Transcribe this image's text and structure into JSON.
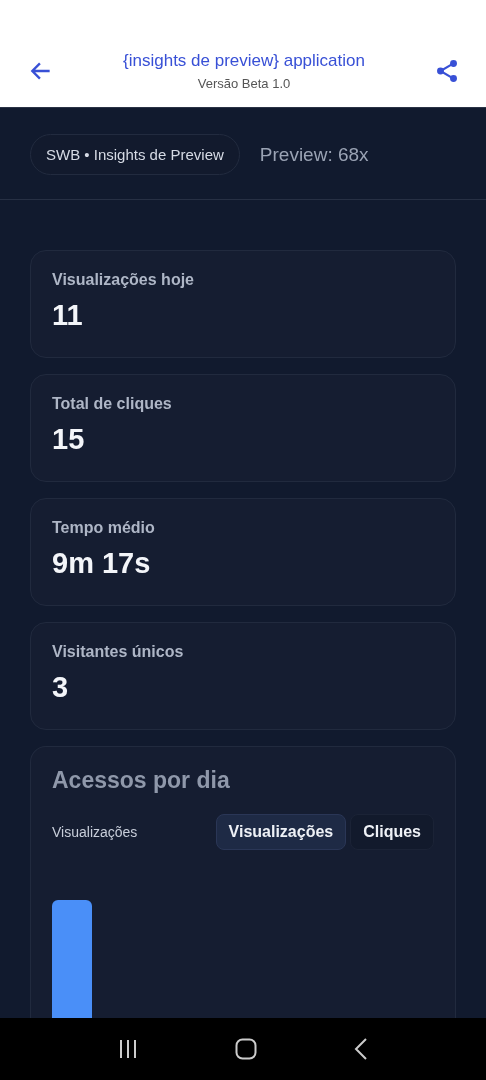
{
  "header": {
    "title": "{insights de preview} application",
    "subtitle": "Versão Beta 1.0"
  },
  "chip": "SWB • Insights de Preview",
  "preview_count": "Preview: 68x",
  "stats": [
    {
      "label": "Visualizações hoje",
      "value": "11"
    },
    {
      "label": "Total de cliques",
      "value": "15"
    },
    {
      "label": "Tempo médio",
      "value": "9m 17s"
    },
    {
      "label": "Visitantes únicos",
      "value": "3"
    }
  ],
  "chart_card": {
    "title": "Acessos por dia",
    "series_label": "Visualizações",
    "tabs": [
      {
        "label": "Visualizações",
        "selected": true
      },
      {
        "label": "Cliques",
        "selected": false
      }
    ]
  }
}
